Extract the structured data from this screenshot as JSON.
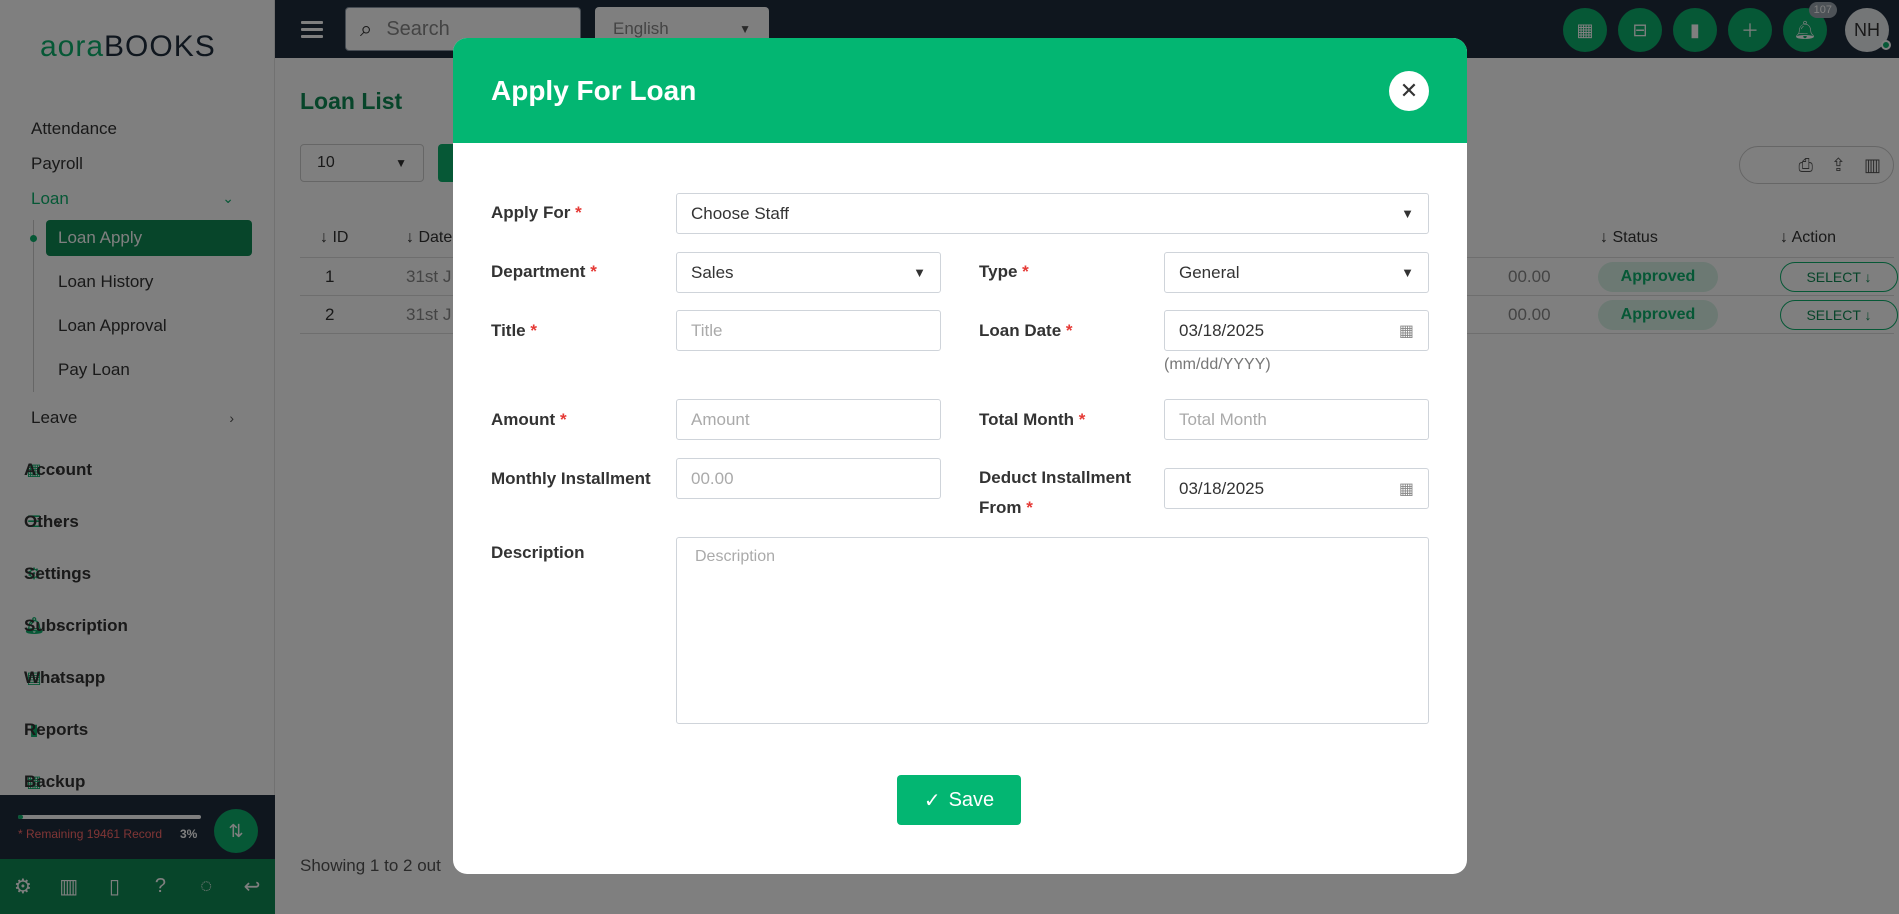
{
  "logo": {
    "part1": "aora",
    "part2": "BOOKS"
  },
  "sidebar": {
    "hr_items": [
      "Attendance",
      "Payroll"
    ],
    "loan_label": "Loan",
    "loan_children": [
      "Loan Apply",
      "Loan History",
      "Loan Approval",
      "Pay Loan"
    ],
    "leave_label": "Leave",
    "main_items": [
      {
        "label": "Account",
        "icon": "calculator-icon"
      },
      {
        "label": "Others",
        "icon": "list-icon"
      },
      {
        "label": "Settings",
        "icon": "gear-icon"
      },
      {
        "label": "Subscription",
        "icon": "bell-icon"
      },
      {
        "label": "Whatsapp",
        "icon": "file-icon"
      },
      {
        "label": "Reports",
        "icon": "bar-chart-icon"
      },
      {
        "label": "Backup",
        "icon": "grid-icon"
      }
    ],
    "usage": {
      "text": "* Remaining 19461 Record",
      "percent_label": "3%",
      "fraction": 0.03
    }
  },
  "topbar": {
    "search_placeholder": "Search",
    "language": "English",
    "notification_count": "107",
    "avatar_initials": "NH"
  },
  "page": {
    "title": "Loan List",
    "per_page": "10",
    "columns": {
      "id": "ID",
      "date": "Date",
      "status": "Status",
      "action": "Action"
    },
    "rows": [
      {
        "id": "1",
        "date": "31st J",
        "amount": "00.00",
        "status": "Approved",
        "action": "SELECT"
      },
      {
        "id": "2",
        "date": "31st J",
        "amount": "00.00",
        "status": "Approved",
        "action": "SELECT"
      }
    ],
    "showing": "Showing 1 to 2 out"
  },
  "modal": {
    "title": "Apply For Loan",
    "apply_for": {
      "label": "Apply For",
      "value": "Choose Staff"
    },
    "department": {
      "label": "Department",
      "value": "Sales"
    },
    "type": {
      "label": "Type",
      "value": "General"
    },
    "title_field": {
      "label": "Title",
      "placeholder": "Title"
    },
    "loan_date": {
      "label": "Loan Date",
      "value": "03/18/2025",
      "hint": "(mm/dd/YYYY)"
    },
    "amount": {
      "label": "Amount",
      "placeholder": "Amount"
    },
    "total_month": {
      "label": "Total Month",
      "placeholder": "Total Month"
    },
    "monthly_installment": {
      "label": "Monthly Installment",
      "placeholder": "00.00"
    },
    "deduct_from": {
      "label_line1": "Deduct Installment",
      "label_line2": "From",
      "value": "03/18/2025"
    },
    "description": {
      "label": "Description",
      "placeholder": "Description"
    },
    "save_label": "Save",
    "required_mark": "*"
  }
}
